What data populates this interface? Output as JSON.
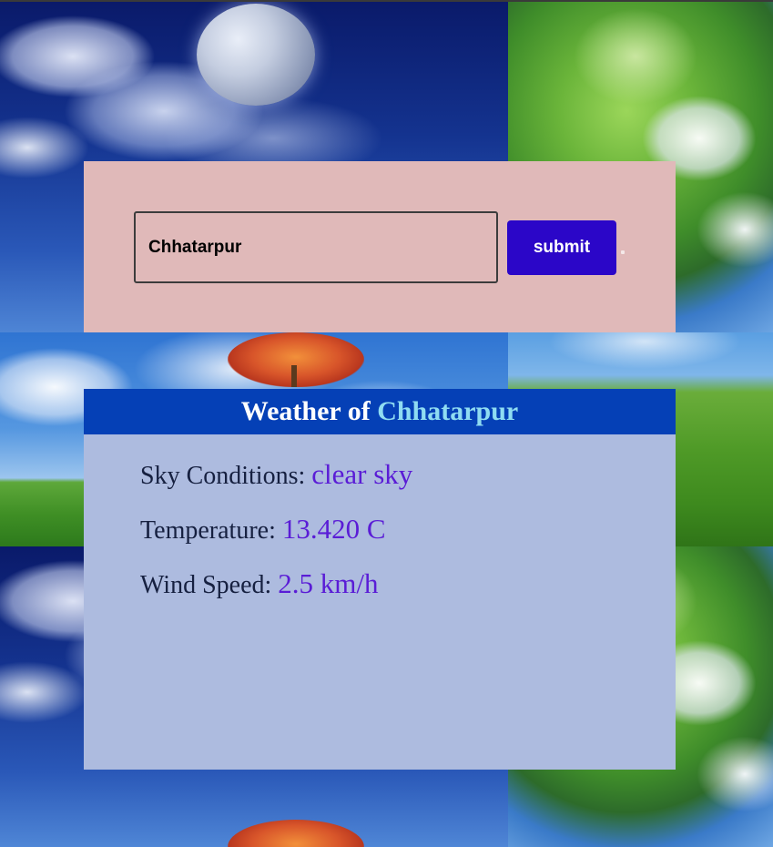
{
  "search": {
    "city_value": "Chhatarpur",
    "submit_label": "submit"
  },
  "weather": {
    "title_prefix": "Weather of ",
    "city": "Chhatarpur",
    "rows": [
      {
        "label": "Sky Conditions: ",
        "value": "clear sky"
      },
      {
        "label": "Temperature: ",
        "value": "13.420 C"
      },
      {
        "label": "Wind Speed: ",
        "value": "2.5 km/h"
      }
    ]
  },
  "colors": {
    "search_panel_bg": "#e0b9b9",
    "submit_button_bg": "#2b06c8",
    "weather_header_bg": "#0540b6",
    "weather_header_city": "#8fdcf2",
    "weather_body_bg": "#adbbdf",
    "weather_value": "#5a1cd6"
  }
}
